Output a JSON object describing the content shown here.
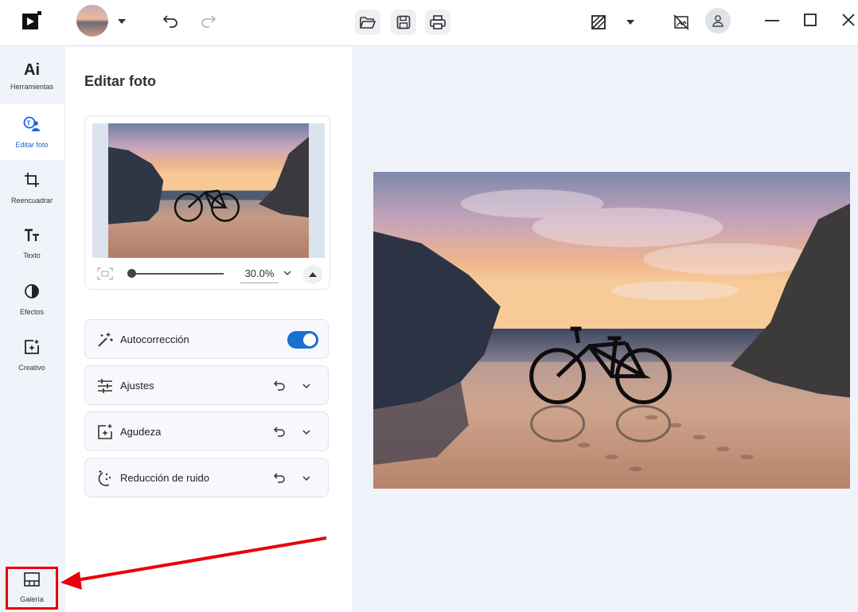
{
  "sidebar": {
    "items": [
      {
        "label": "Herramientas",
        "icon": "ai-icon"
      },
      {
        "label": "Editar foto",
        "icon": "edit-photo-icon"
      },
      {
        "label": "Reencuadrar",
        "icon": "crop-icon"
      },
      {
        "label": "Texto",
        "icon": "text-icon"
      },
      {
        "label": "Efectos",
        "icon": "effects-icon"
      },
      {
        "label": "Creativo",
        "icon": "creative-icon"
      }
    ],
    "gallery": {
      "label": "Galería",
      "icon": "gallery-icon"
    },
    "ai_glyph": "Ai"
  },
  "panel": {
    "title": "Editar foto",
    "zoom": {
      "value": "30.0%",
      "level": 0.0
    },
    "tools": [
      {
        "label": "Autocorrección",
        "icon": "magic-wand-icon",
        "toggle": true
      },
      {
        "label": "Ajustes",
        "icon": "sliders-icon"
      },
      {
        "label": "Agudeza",
        "icon": "sharpen-icon"
      },
      {
        "label": "Reducción de ruido",
        "icon": "denoise-icon"
      }
    ]
  },
  "colors": {
    "accent": "#1a6fd1",
    "highlight": "#e8000b",
    "active_nav_text": "#1565d8"
  }
}
